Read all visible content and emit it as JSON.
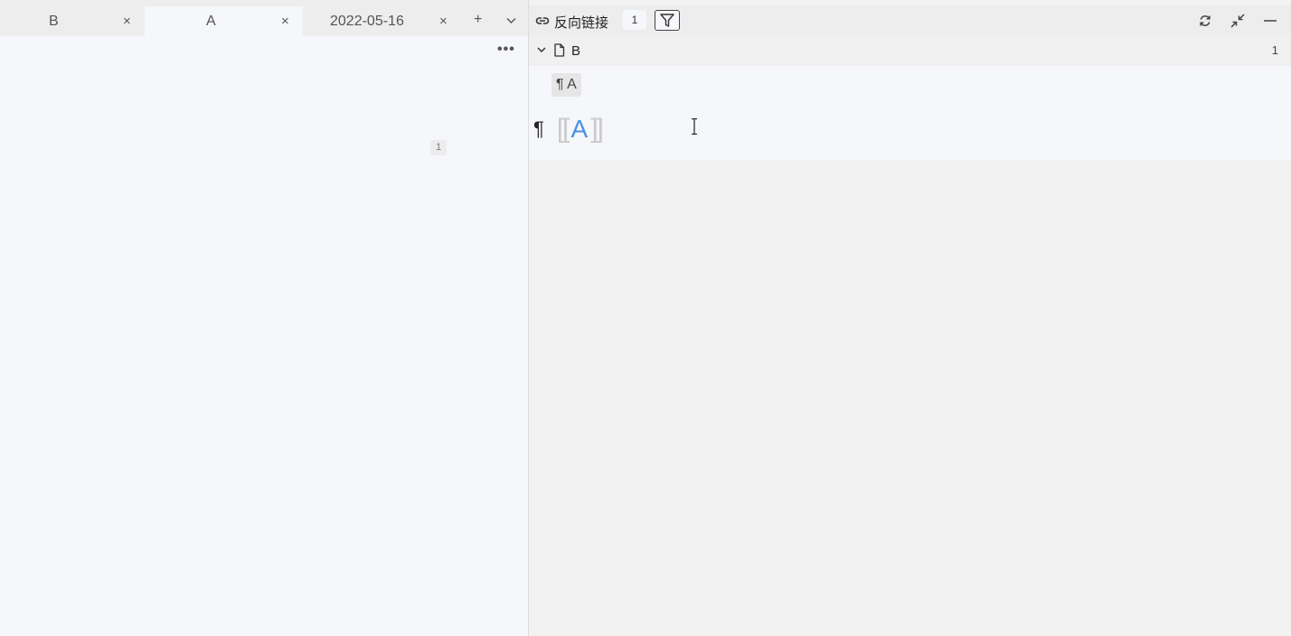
{
  "left": {
    "tabs": [
      {
        "label": "B",
        "close": "×",
        "active": false
      },
      {
        "label": "A",
        "close": "×",
        "active": true
      },
      {
        "label": "2022-05-16",
        "close": "×",
        "active": false
      }
    ],
    "add_tab": "+",
    "tab_menu": "⌄",
    "more": "•••",
    "ref_count": "1"
  },
  "right": {
    "title": "反向链接",
    "count": "1",
    "icons": [
      "link-icon",
      "filter-icon",
      "refresh-icon",
      "collapse-icon",
      "minimize-icon"
    ],
    "group": {
      "name": "B",
      "count": "1",
      "breadcrumb": "¶ A",
      "paragraph": {
        "pilcrow": "¶",
        "open_bracket": "[[",
        "link_text": "A",
        "close_bracket": "]]"
      }
    }
  },
  "colors": {
    "accent": "#4a90e2",
    "bracket": "#c9c9c9",
    "tabbar": "#ededed",
    "editor_bg": "#f6f7fa"
  }
}
